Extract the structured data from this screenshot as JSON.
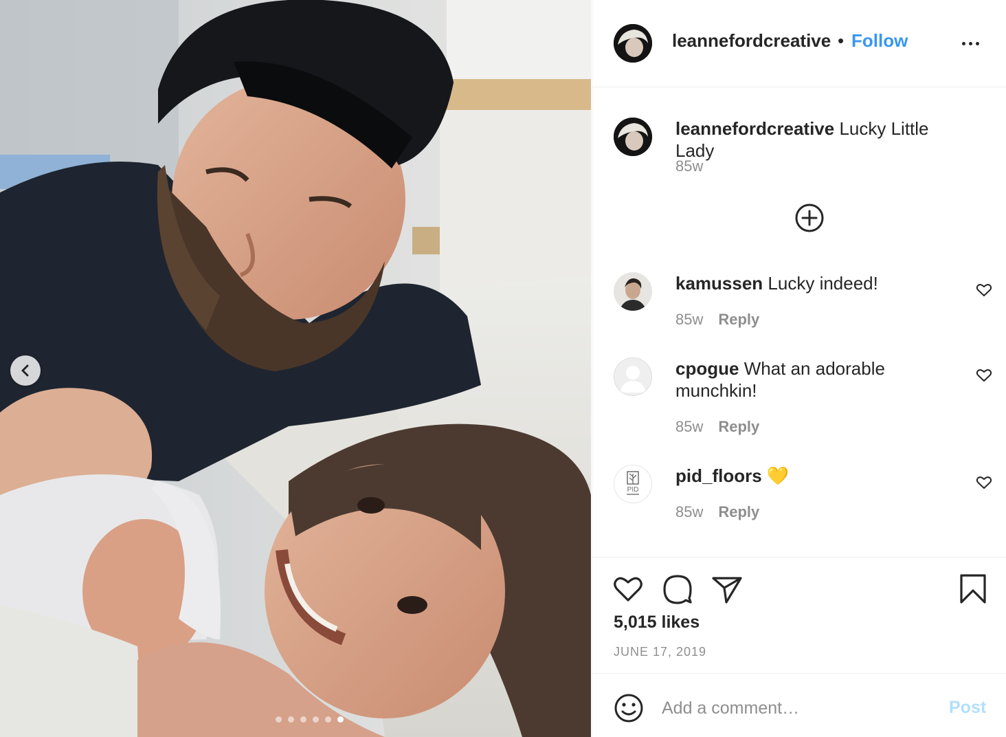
{
  "post": {
    "author": "leannefordcreative",
    "separator": "•",
    "follow_label": "Follow",
    "more_icon": "more-options-icon",
    "caption": {
      "username": "leannefordcreative",
      "text": "Lucky Little Lady",
      "time": "85w"
    },
    "load_more_icon": "plus-circle-icon",
    "comments": [
      {
        "username": "kamussen",
        "text": "Lucky indeed!",
        "time": "85w",
        "reply_label": "Reply"
      },
      {
        "username": "cpogue",
        "text": "What an adorable munchkin!",
        "time": "85w",
        "reply_label": "Reply"
      },
      {
        "username": "pid_floors",
        "text": "💛",
        "time": "85w",
        "reply_label": "Reply"
      }
    ],
    "likes": "5,015 likes",
    "date": "JUNE 17, 2019",
    "comment_placeholder": "Add a comment…",
    "post_label": "Post",
    "carousel": {
      "total": 6,
      "active": 6
    },
    "avatar_logo_text": "PID",
    "colors": {
      "accent": "#3897f0",
      "post_disabled": "#b2dffc",
      "muted": "#8e8e8e",
      "text": "#262626"
    }
  }
}
